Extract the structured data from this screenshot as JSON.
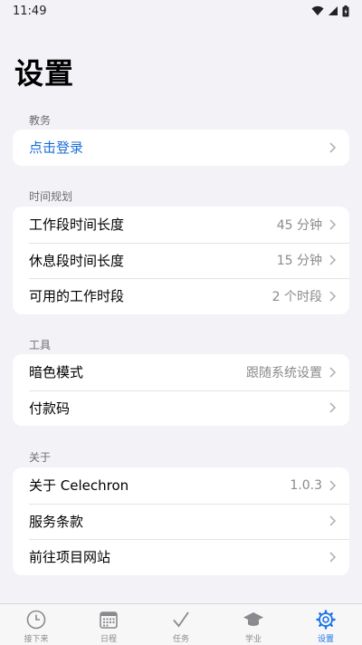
{
  "status_bar": {
    "time": "11:49"
  },
  "page": {
    "title": "设置"
  },
  "sections": [
    {
      "header": "教务",
      "rows": [
        {
          "label": "点击登录",
          "value": "",
          "link": true
        }
      ]
    },
    {
      "header": "时间规划",
      "rows": [
        {
          "label": "工作段时间长度",
          "value": "45 分钟"
        },
        {
          "label": "休息段时间长度",
          "value": "15 分钟"
        },
        {
          "label": "可用的工作时段",
          "value": "2 个时段"
        }
      ]
    },
    {
      "header": "工具",
      "rows": [
        {
          "label": "暗色模式",
          "value": "跟随系统设置"
        },
        {
          "label": "付款码",
          "value": ""
        }
      ]
    },
    {
      "header": "关于",
      "rows": [
        {
          "label": "关于 Celechron",
          "value": "1.0.3"
        },
        {
          "label": "服务条款",
          "value": ""
        },
        {
          "label": "前往项目网站",
          "value": ""
        }
      ]
    }
  ],
  "tab_bar": {
    "tabs": [
      {
        "label": "接下来",
        "icon": "clock-icon"
      },
      {
        "label": "日程",
        "icon": "calendar-icon"
      },
      {
        "label": "任务",
        "icon": "checkmark-icon"
      },
      {
        "label": "学业",
        "icon": "graduation-cap-icon"
      },
      {
        "label": "设置",
        "icon": "gear-icon",
        "active": true
      }
    ]
  },
  "colors": {
    "accent": "#1a73e8",
    "link": "#1a6fd9",
    "background": "#f2f2f7"
  }
}
